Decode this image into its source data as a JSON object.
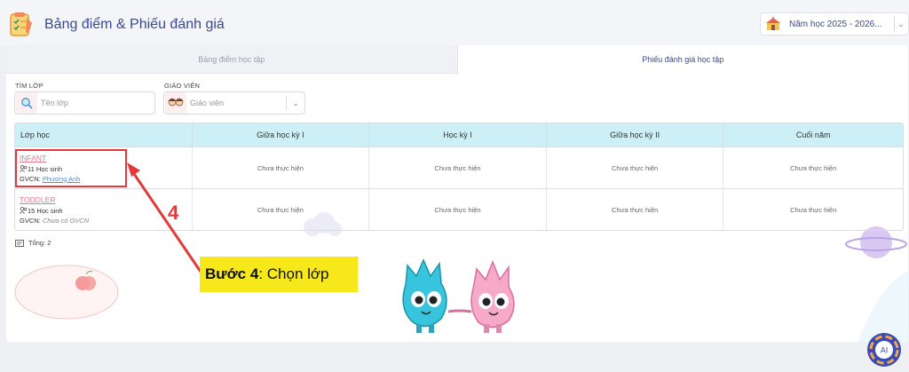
{
  "header": {
    "title": "Bảng điểm & Phiếu đánh giá",
    "school_year": "Năm học 2025 - 2026..."
  },
  "tabs": [
    {
      "label": "Bảng điểm học tập",
      "active": false
    },
    {
      "label": "Phiếu đánh giá học tập",
      "active": true
    }
  ],
  "filters": {
    "class_label": "TÌM LỚP",
    "class_placeholder": "Tên lớp",
    "teacher_label": "GIÁO VIÊN",
    "teacher_placeholder": "Giáo viên"
  },
  "table": {
    "headers": [
      "Lớp học",
      "Giữa học kỳ I",
      "Học kỳ I",
      "Giữa học kỳ II",
      "Cuối năm"
    ],
    "rows": [
      {
        "class_name": "INFANT",
        "students": "11 Học sinh",
        "teacher_prefix": "GVCN:",
        "teacher": "Phương Anh",
        "statuses": [
          "Chưa thực hiện",
          "Chưa thực hiện",
          "Chưa thực hiện",
          "Chưa thực hiện"
        ]
      },
      {
        "class_name": "TODDLER",
        "students": "15 Học sinh",
        "teacher_prefix": "GVCN:",
        "teacher": "Chưa có GVCN",
        "statuses": [
          "Chưa thực hiện",
          "Chưa thực hiện",
          "Chưa thực hiện",
          "Chưa thực hiện"
        ]
      }
    ],
    "total": "Tổng: 2"
  },
  "annotation": {
    "step_number": "4",
    "step_label_bold": "Bước 4",
    "step_label_rest": ": Chọn lớp",
    "color": "#e23a3a",
    "label_bg": "#f7e81c"
  },
  "ai_button": {
    "label": "AI"
  },
  "colors": {
    "title": "#3b4a8f",
    "table_header_bg": "#cdeff6",
    "class_link": "#e4788c",
    "teacher_link": "#5b8bd6"
  }
}
